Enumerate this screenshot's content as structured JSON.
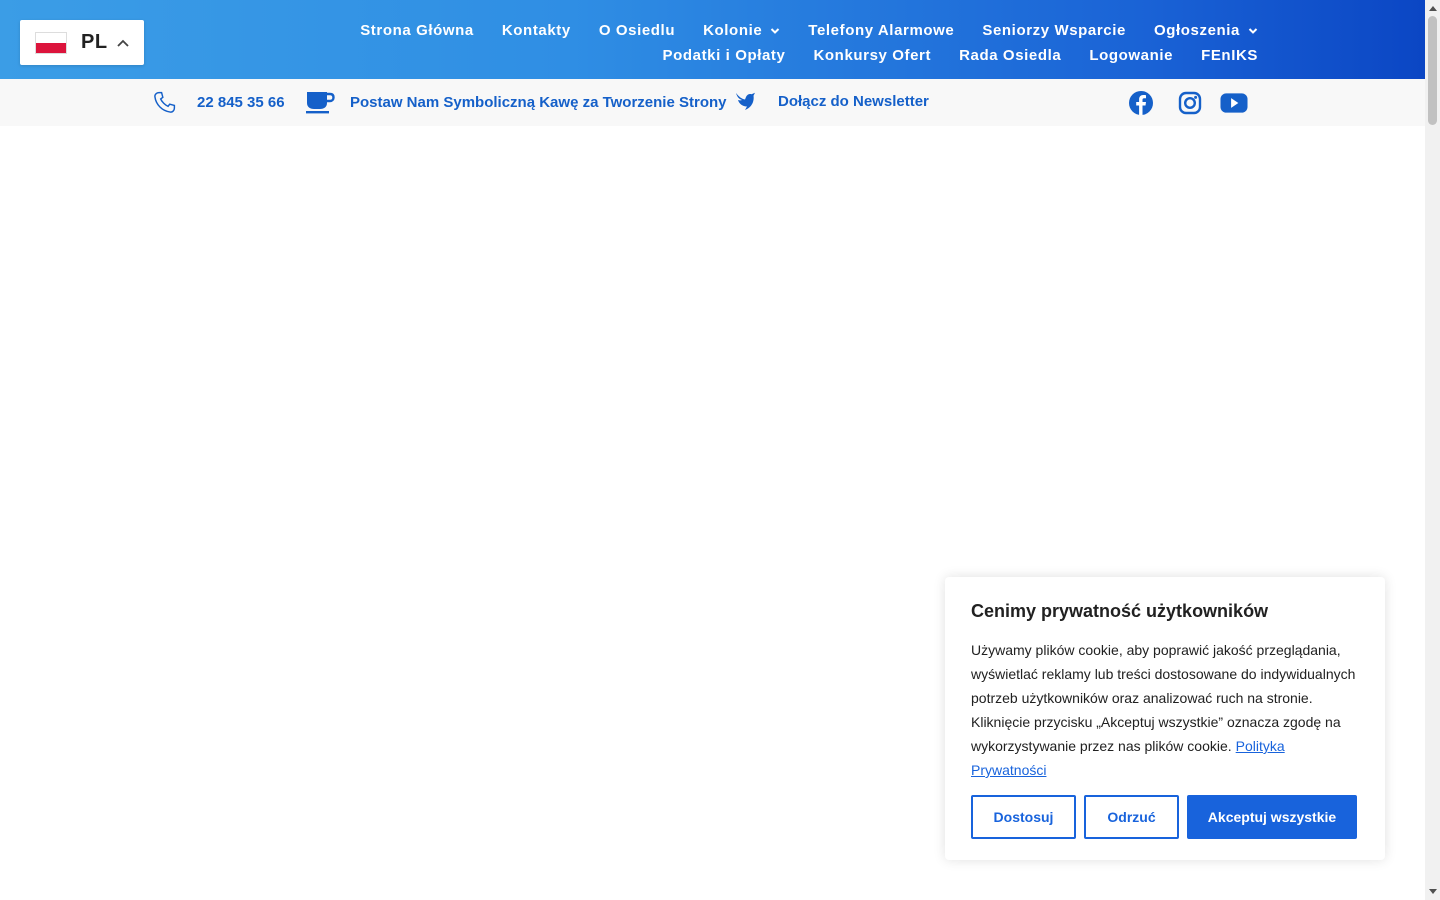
{
  "language": {
    "code": "PL",
    "flag": "poland-flag-icon"
  },
  "nav": {
    "row1": [
      {
        "label": "Strona Główna",
        "dropdown": false
      },
      {
        "label": "Kontakty",
        "dropdown": false
      },
      {
        "label": "O Osiedlu",
        "dropdown": false
      },
      {
        "label": "Kolonie",
        "dropdown": true
      },
      {
        "label": "Telefony Alarmowe",
        "dropdown": false
      },
      {
        "label": "Seniorzy Wsparcie",
        "dropdown": false
      },
      {
        "label": "Ogłoszenia",
        "dropdown": true
      }
    ],
    "row2": [
      {
        "label": "Podatki i Opłaty"
      },
      {
        "label": "Konkursy Ofert"
      },
      {
        "label": "Rada Osiedla"
      },
      {
        "label": "Logowanie"
      },
      {
        "label": "FEnIKS"
      }
    ]
  },
  "infobar": {
    "phone": "22 845 35 66",
    "coffee": "Postaw Nam Symboliczną Kawę za Tworzenie Strony",
    "newsletter": "Dołącz do Newsletter",
    "social": [
      "facebook-icon",
      "instagram-icon",
      "youtube-icon"
    ]
  },
  "cookie": {
    "title": "Cenimy prywatność użytkowników",
    "text": "Używamy plików cookie, aby poprawić jakość przeglądania, wyświetlać reklamy lub treści dostosowane do indywidualnych potrzeb użytkowników oraz analizować ruch na stronie. Kliknięcie przycisku „Akceptuj wszystkie” oznacza zgodę na wykorzystywanie przez nas plików cookie.",
    "link": "Polityka Prywatności",
    "buttons": {
      "customize": "Dostosuj",
      "reject": "Odrzuć",
      "accept": "Akceptuj wszystkie"
    }
  },
  "colors": {
    "brand": "#1863dc",
    "info_text": "#1560c9",
    "header_start": "#3b9de6",
    "header_end": "#0b46c4"
  }
}
